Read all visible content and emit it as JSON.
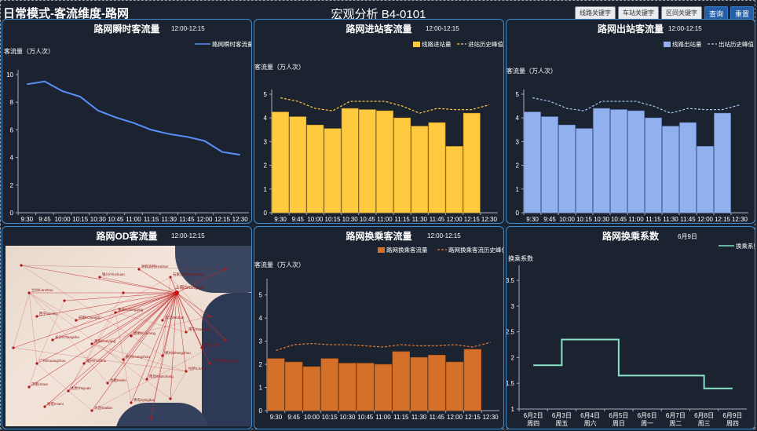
{
  "header": {
    "mode_title": "日常模式-客流维度-路网",
    "center_title": "宏观分析 B4-0101",
    "buttons": {
      "line_key": "线路关键字",
      "station_key": "车站关键字",
      "section_key": "区间关键字",
      "query": "查询",
      "reset": "重置"
    }
  },
  "panels": {
    "instant": {
      "title": "路网瞬时客流量",
      "time": "12:00-12:15",
      "ylabel": "客流量（万人次）",
      "legend": "路网瞬时客流量"
    },
    "entry": {
      "title": "路网进站客流量",
      "time": "12:00-12:15",
      "ylabel": "客流量（万人次）",
      "legend_bar": "线路进站量",
      "legend_line": "进站历史峰值"
    },
    "exit": {
      "title": "路网出站客流量",
      "time": "12:00-12:15",
      "ylabel": "客流量（万人次）",
      "legend_bar": "线路出站量",
      "legend_line": "出站历史峰值"
    },
    "od": {
      "title": "路网OD客流量",
      "time": "12:00-12:15"
    },
    "transfer": {
      "title": "路网换乘客流量",
      "time": "12:00-12:15",
      "ylabel": "客流量（万人次）",
      "legend_bar": "路网换乘客流量",
      "legend_line": "路网换乘客流历史峰值"
    },
    "coef": {
      "title": "路网换乘系数",
      "time": "6月9日",
      "ylabel": "换乘系数",
      "legend": "换乘系数"
    }
  },
  "colors": {
    "line_blue": "#5b8ff9",
    "bar_yellow": "#ffc940",
    "bar_blue": "#90b0ee",
    "bar_orange": "#d5702a",
    "line_green": "#88e0c8",
    "panel_border": "#3b8bd0"
  },
  "chart_data": [
    {
      "type": "line",
      "title": "路网瞬时客流量",
      "categories": [
        "9:30",
        "9:45",
        "10:00",
        "10:15",
        "10:30",
        "10:45",
        "11:00",
        "11:15",
        "11:30",
        "11:45",
        "12:00",
        "12:15",
        "12:30"
      ],
      "series": [
        {
          "name": "路网瞬时客流量",
          "values": [
            9.3,
            9.5,
            8.8,
            8.4,
            7.4,
            6.9,
            6.5,
            6.0,
            5.7,
            5.5,
            5.2,
            4.4,
            4.2
          ]
        }
      ],
      "ylim": [
        0,
        10
      ],
      "yticks": [
        0,
        2,
        4,
        6,
        8,
        10
      ]
    },
    {
      "type": "bar",
      "title": "路网进站客流量",
      "categories": [
        "9:30",
        "9:45",
        "10:00",
        "10:15",
        "10:30",
        "10:45",
        "11:00",
        "11:15",
        "11:30",
        "11:45",
        "12:00",
        "12:15",
        "12:30"
      ],
      "series": [
        {
          "name": "线路进站量",
          "values": [
            4.25,
            4.05,
            3.7,
            3.55,
            4.4,
            4.35,
            4.3,
            4.0,
            3.65,
            3.8,
            2.8,
            4.2
          ]
        },
        {
          "name": "进站历史峰值",
          "values": [
            4.85,
            4.7,
            4.4,
            4.3,
            4.7,
            4.7,
            4.7,
            4.5,
            4.2,
            4.4,
            4.35,
            4.35,
            4.55
          ]
        }
      ],
      "ylim": [
        0,
        5
      ],
      "yticks": [
        0,
        1,
        2,
        3,
        4,
        5
      ]
    },
    {
      "type": "bar",
      "title": "路网出站客流量",
      "categories": [
        "9:30",
        "9:45",
        "10:00",
        "10:15",
        "10:30",
        "10:45",
        "11:00",
        "11:15",
        "11:30",
        "11:45",
        "12:00",
        "12:15",
        "12:30"
      ],
      "series": [
        {
          "name": "线路出站量",
          "values": [
            4.25,
            4.05,
            3.7,
            3.55,
            4.4,
            4.35,
            4.3,
            4.0,
            3.65,
            3.8,
            2.8,
            4.2
          ]
        },
        {
          "name": "出站历史峰值",
          "values": [
            4.85,
            4.7,
            4.4,
            4.3,
            4.7,
            4.7,
            4.7,
            4.5,
            4.2,
            4.4,
            4.35,
            4.35,
            4.55
          ]
        }
      ],
      "ylim": [
        0,
        5
      ],
      "yticks": [
        0,
        1,
        2,
        3,
        4,
        5
      ]
    },
    {
      "type": "bar",
      "title": "路网换乘客流量",
      "categories": [
        "9:30",
        "9:45",
        "10:00",
        "10:15",
        "10:30",
        "10:45",
        "11:00",
        "11:15",
        "11:30",
        "11:45",
        "12:00",
        "12:15",
        "12:30"
      ],
      "series": [
        {
          "name": "路网换乘客流量",
          "values": [
            2.25,
            2.1,
            1.9,
            2.25,
            2.05,
            2.05,
            2.0,
            2.55,
            2.3,
            2.4,
            2.1,
            2.65
          ]
        },
        {
          "name": "路网换乘客流历史峰值",
          "values": [
            2.6,
            2.85,
            2.9,
            2.85,
            2.85,
            2.8,
            2.75,
            2.85,
            2.8,
            2.8,
            2.85,
            2.75,
            2.95
          ]
        }
      ],
      "ylim": [
        0,
        5.5
      ],
      "yticks": [
        0,
        1,
        2,
        3,
        4,
        5
      ]
    },
    {
      "type": "line",
      "title": "路网换乘系数",
      "categories": [
        "6月2日\n周四",
        "6月3日\n周五",
        "6月4日\n周六",
        "6月5日\n周日",
        "6月6日\n周一",
        "6月7日\n周二",
        "6月8日\n周三",
        "6月9日\n周四"
      ],
      "series": [
        {
          "name": "换乘系数",
          "values": [
            1.85,
            2.35,
            2.35,
            1.65,
            1.65,
            1.65,
            1.4,
            1.4
          ]
        }
      ],
      "step": true,
      "ylim": [
        1,
        3.7
      ],
      "yticks": [
        1,
        1.5,
        2,
        2.5,
        3,
        3.5
      ]
    }
  ],
  "od_map": {
    "hub_label": "上海/Shanghai",
    "city_labels": [
      "兰州/Lanzhou",
      "银川/Yinchuan",
      "呼和浩特/Hohhot",
      "石家庄/Shijiazhuang",
      "西宁/Xining",
      "成都/Chengdu",
      "重庆/Chongqing",
      "武汉/Wuhan",
      "长沙/Changsha",
      "贵阳/Guiyang",
      "昆明/Kunming",
      "南宁/Nanning",
      "广州/Guangzhou",
      "福州/Fuzhou",
      "杭州/Hangzhou",
      "郑州/Zhengzhou",
      "西安/Xi'an",
      "济南/Jinan",
      "太原/Taiyuan",
      "合肥/Hefei",
      "南昌/Nanchang",
      "拉萨/Lhasa",
      "乌鲁木齐/Urumqi",
      "哈密/Hami",
      "大连/Dalian",
      "青岛/Qingdao"
    ]
  }
}
